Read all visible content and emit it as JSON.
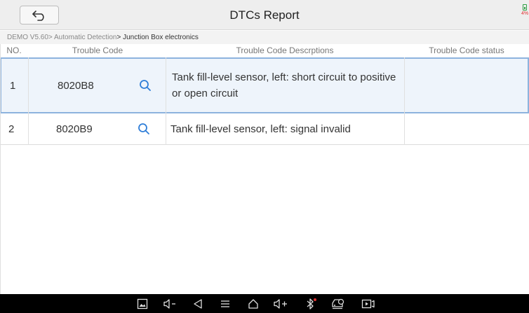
{
  "header": {
    "title": "DTCs Report",
    "battery_percent": "4%"
  },
  "breadcrumb": {
    "part1": "DEMO V5.60",
    "part2": "> Automatic Detection",
    "part3": "> Junction Box electronics"
  },
  "table": {
    "columns": [
      "NO.",
      "Trouble Code",
      "Trouble Code Descrptions",
      "Trouble Code status"
    ],
    "rows": [
      {
        "no": "1",
        "code": "8020B8",
        "description": "Tank fill-level sensor, left: short circuit to positive or open circuit",
        "status": "",
        "selected": true
      },
      {
        "no": "2",
        "code": "8020B9",
        "description": "Tank fill-level sensor, left: signal invalid",
        "status": "",
        "selected": false
      }
    ]
  },
  "navbar": {
    "icons": [
      "screenshot-icon",
      "volume-down-icon",
      "back-icon",
      "menu-icon",
      "home-icon",
      "volume-up-icon",
      "bluetooth-icon",
      "vci-car-icon",
      "screen-record-icon"
    ]
  },
  "colors": {
    "accent": "#2f7ed8",
    "selected_row_bg": "#eef4fb",
    "selected_row_border": "#8db3de",
    "battery_green": "#2f9e44",
    "battery_red": "#e03131"
  }
}
